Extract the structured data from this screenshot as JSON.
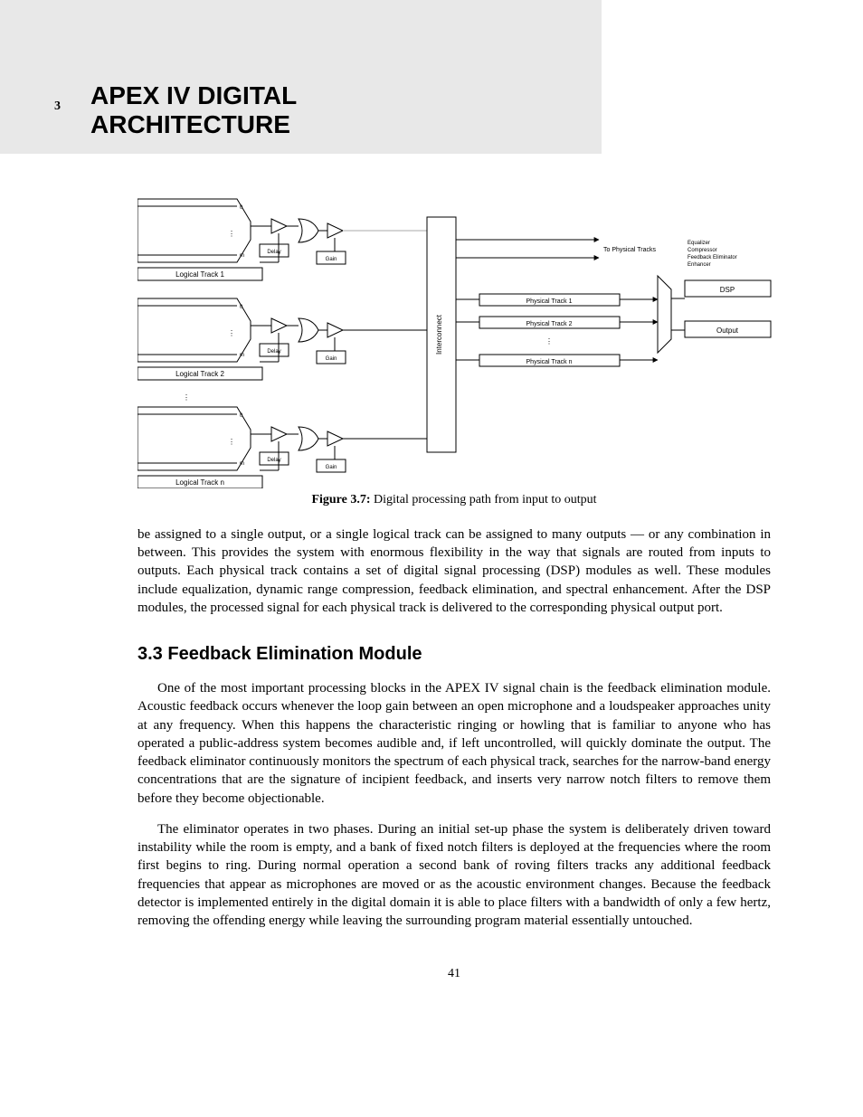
{
  "header": {
    "chapterNum": "3",
    "chapterTitle_l1": "APEX IV DIGITAL",
    "chapterTitle_l2": "ARCHITECTURE"
  },
  "figure": {
    "mux_in_top": "0",
    "mux_in_bot": "m",
    "track1": "Logical Track 1",
    "track2": "Logical Track 2",
    "trackn": "Logical Track n",
    "delay": "Delay",
    "gain": "Gain",
    "interconnect": "Interconnect",
    "dots_v": "⋮",
    "phys_track1": "Physical Track 1",
    "phys_track2": "Physical Track 2",
    "phys_trackn": "Physical Track n",
    "arrows_to": "To Physical Tracks",
    "dsp": "DSP",
    "output": "Output",
    "dsp_items": "Equalizer\nCompressor\nFeedback Eliminator\nEnhancer"
  },
  "caption": {
    "label": "Figure 3.7:",
    "text": "Digital processing path from input to output"
  },
  "para1": "be assigned to a single output, or a single logical track can be assigned to many outputs — or any combination in between. This provides the system with enormous flexibility in the way that signals are routed from inputs to outputs. Each physical track contains a set of digital signal processing (DSP) modules as well. These modules include equalization, dynamic range compression, feedback elimination, and spectral enhancement. After the DSP modules, the processed signal for each physical track is delivered to the corresponding physical output port.",
  "sec_title": "3.3 Feedback Elimination Module",
  "para2": "One of the most important processing blocks in the APEX IV signal chain is the feedback elimination module. Acoustic feedback occurs whenever the loop gain between an open microphone and a loudspeaker approaches unity at any frequency. When this happens the characteristic ringing or howling that is familiar to anyone who has operated a public-address system becomes audible and, if left uncontrolled, will quickly dominate the output. The feedback eliminator continuously monitors the spectrum of each physical track, searches for the narrow-band energy concentrations that are the signature of incipient feedback, and inserts very narrow notch filters to remove them before they become objectionable.",
  "para3": "The eliminator operates in two phases. During an initial set-up phase the system is deliberately driven toward instability while the room is empty, and a bank of fixed notch filters is deployed at the frequencies where the room first begins to ring. During normal operation a second bank of roving filters tracks any additional feedback frequencies that appear as microphones are moved or as the acoustic environment changes. Because the feedback detector is implemented entirely in the digital domain it is able to place filters with a bandwidth of only a few hertz, removing the offending energy while leaving the surrounding program material essentially untouched.",
  "pagenum": "41"
}
